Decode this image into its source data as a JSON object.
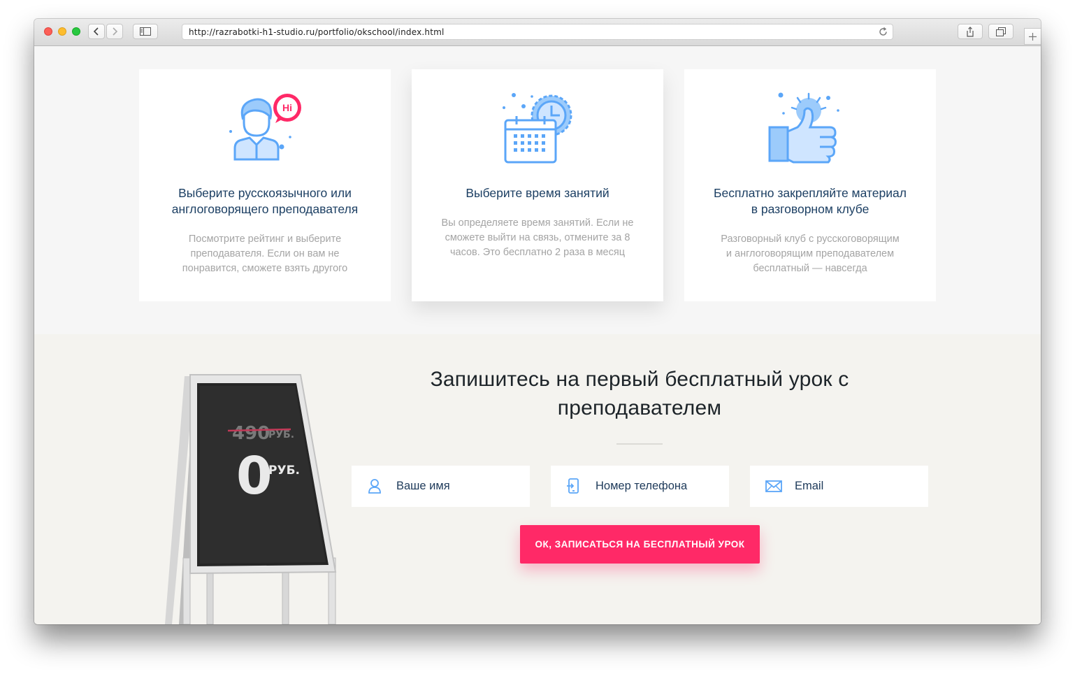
{
  "browser": {
    "url": "http://razrabotki-h1-studio.ru/portfolio/okschool/index.html"
  },
  "features": [
    {
      "icon": "teacher-hi-icon",
      "title_line1": "Выберите русскоязычного или",
      "title_line2": "англоговорящего преподавателя",
      "desc_line1": "Посмотрите рейтинг и выберите",
      "desc_line2": "преподавателя. Если он вам не",
      "desc_line3": "понравится, сможете взять другого",
      "badge": "Hi"
    },
    {
      "icon": "calendar-clock-icon",
      "title_line1": "Выберите время занятий",
      "desc_line1": "Вы определяете время занятий. Если не",
      "desc_line2": "сможете выйти на связь, отмените за 8",
      "desc_line3": "часов. Это бесплатно 2 раза в месяц"
    },
    {
      "icon": "thumbs-up-icon",
      "title_line1": "Бесплатно закрепляйте материал",
      "title_line2": "в разговорном клубе",
      "desc_line1": "Разговорный клуб с русскоговорящим",
      "desc_line2": "и англоговорящим преподавателем",
      "desc_line3": "бесплатный — навсегда"
    }
  ],
  "signup": {
    "title_line1": "Запишитесь на первый бесплатный урок с",
    "title_line2": "преподавателем",
    "name_placeholder": "Ваше имя",
    "phone_placeholder": "Номер телефона",
    "email_placeholder": "Email",
    "submit_label": "ОК, ЗАПИСАТЬСЯ НА БЕСПЛАТНЫЙ УРОК"
  },
  "chalkboard": {
    "old_price": "490",
    "old_currency": "РУБ.",
    "new_price": "0",
    "new_currency": "РУБ."
  },
  "colors": {
    "accent": "#ff2967",
    "icon_blue": "#5ba6f8",
    "title_blue": "#1c3f63"
  }
}
